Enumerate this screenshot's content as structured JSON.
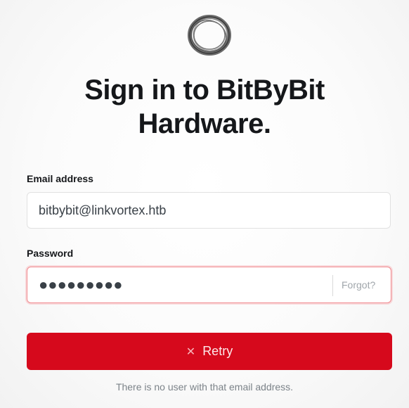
{
  "logo": {
    "icon": "ring-logo-icon"
  },
  "title": {
    "line1": "Sign in to BitByBit",
    "line2": "Hardware."
  },
  "email": {
    "label": "Email address",
    "value": "bitbybit@linkvortex.htb"
  },
  "password": {
    "label": "Password",
    "masked_value": "●●●●●●●●●",
    "forgot_label": "Forgot?"
  },
  "submit": {
    "label": "Retry",
    "icon": "close-icon"
  },
  "status": {
    "error": "There is no user with that email address."
  },
  "colors": {
    "accent": "#d6091c",
    "error_border": "#f08a8f"
  }
}
